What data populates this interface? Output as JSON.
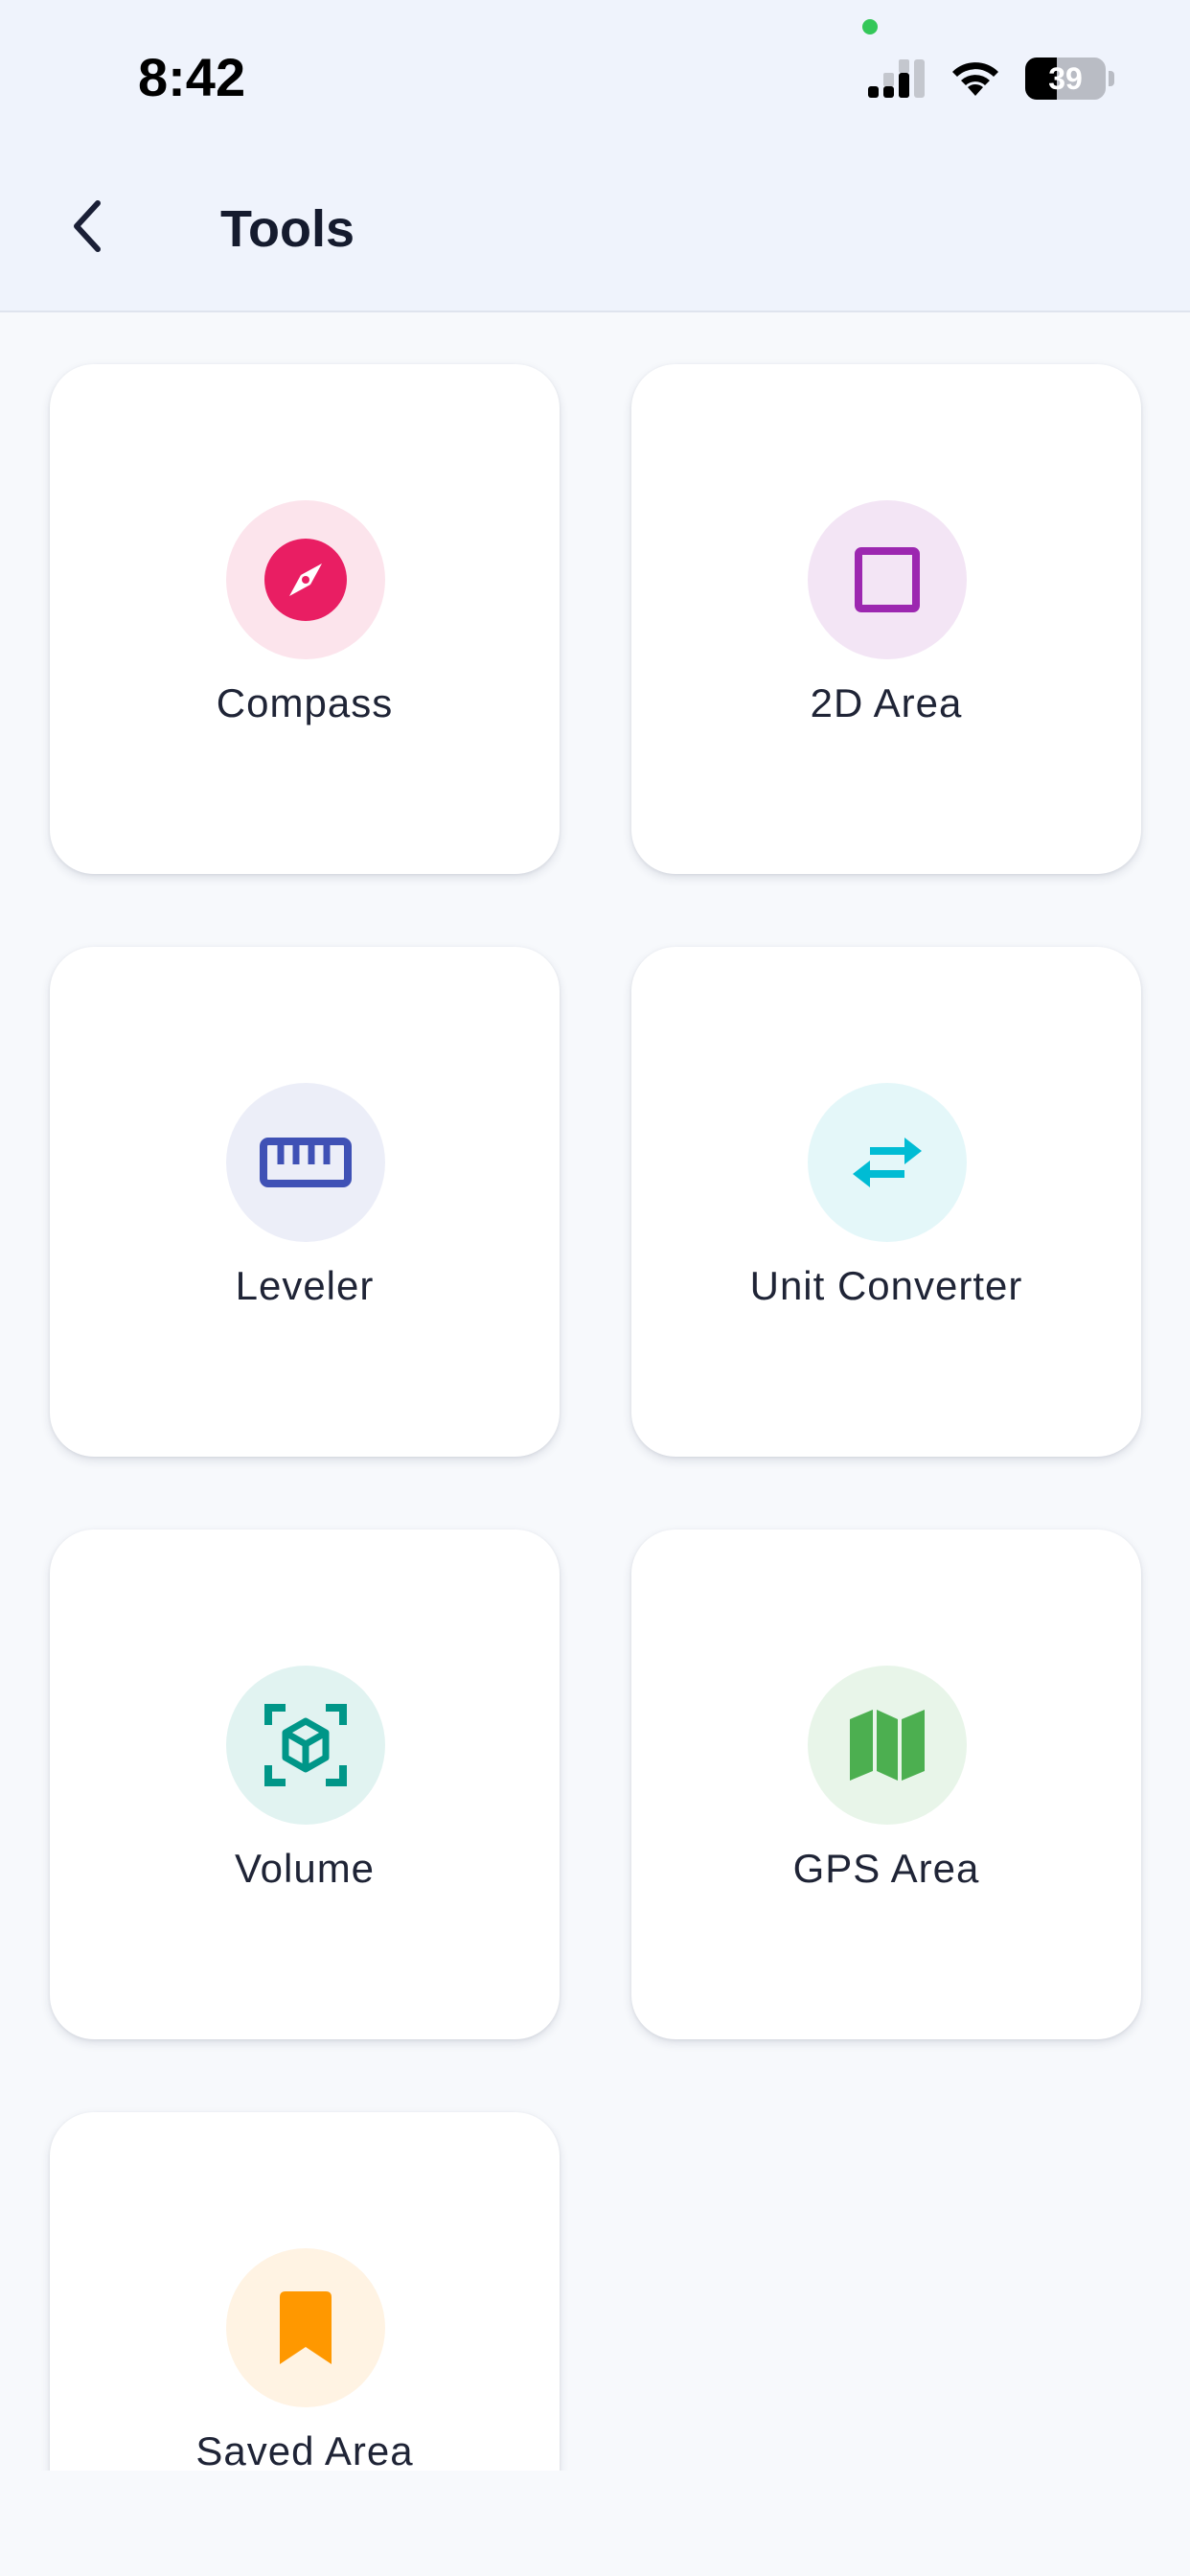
{
  "status_bar": {
    "time": "8:42",
    "battery_percent": 39,
    "battery_text": "39"
  },
  "header": {
    "title": "Tools",
    "back_icon": "chevron-left-icon"
  },
  "colors": {
    "header_bg": "#eff3fc",
    "page_bg": "#f7f9fc"
  },
  "tools": [
    {
      "label": "Compass",
      "icon": "compass-icon",
      "color": "#e91e63",
      "bg": "#fce4ec"
    },
    {
      "label": "2D Area",
      "icon": "square-outline-icon",
      "color": "#9c27b0",
      "bg": "#f3e5f5"
    },
    {
      "label": "Leveler",
      "icon": "ruler-icon",
      "color": "#3f51b5",
      "bg": "#eceef8"
    },
    {
      "label": "Unit Converter",
      "icon": "swap-arrows-icon",
      "color": "#00bcd4",
      "bg": "#e4f7f9"
    },
    {
      "label": "Volume",
      "icon": "cube-scan-icon",
      "color": "#009688",
      "bg": "#e1f3f1"
    },
    {
      "label": "GPS Area",
      "icon": "map-icon",
      "color": "#4caf50",
      "bg": "#e8f5e9"
    },
    {
      "label": "Saved Area",
      "icon": "bookmark-icon",
      "color": "#ff9800",
      "bg": "#fff3e3"
    }
  ]
}
